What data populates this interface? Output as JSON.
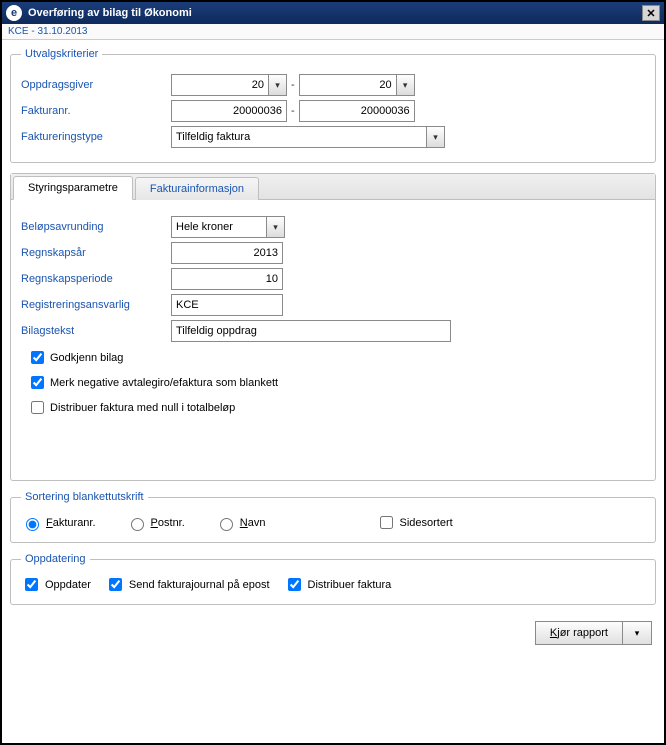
{
  "window": {
    "icon_letter": "e",
    "title": "Overføring av bilag til Økonomi"
  },
  "subheader": "KCE - 31.10.2013",
  "utvalg": {
    "legend": "Utvalgskriterier",
    "oppdragsgiver_label": "Oppdragsgiver",
    "oppdragsgiver_from": "20",
    "oppdragsgiver_to": "20",
    "fakturanr_label": "Fakturanr.",
    "fakturanr_from": "20000036",
    "fakturanr_to": "20000036",
    "faktureringstype_label": "Faktureringstype",
    "faktureringstype_value": "Tilfeldig faktura"
  },
  "tabs": {
    "styring": "Styringsparametre",
    "info": "Fakturainformasjon"
  },
  "styring": {
    "belopsavrunding_label": "Beløpsavrunding",
    "belopsavrunding_value": "Hele kroner",
    "regnskapsar_label": "Regnskapsår",
    "regnskapsar_value": "2013",
    "regnskapsperiode_label": "Regnskapsperiode",
    "regnskapsperiode_value": "10",
    "registreringsansvarlig_label": "Registreringsansvarlig",
    "registreringsansvarlig_value": "KCE",
    "bilagstekst_label": "Bilagstekst",
    "bilagstekst_value": "Tilfeldig oppdrag",
    "godkjenn_label": "Godkjenn bilag",
    "merk_neg_label": "Merk negative avtalegiro/efaktura som blankett",
    "distribuer_null_label": "Distribuer faktura med null i totalbeløp"
  },
  "sortering": {
    "legend": "Sortering blankettutskrift",
    "fakturanr": "Fakturanr.",
    "postnr": "Postnr.",
    "navn": "Navn",
    "sidesortert": "Sidesortert"
  },
  "oppdatering": {
    "legend": "Oppdatering",
    "oppdater": "Oppdater",
    "send_epost": "Send fakturajournal på epost",
    "distribuer": "Distribuer faktura"
  },
  "footer": {
    "run": "Kjør rapport"
  }
}
